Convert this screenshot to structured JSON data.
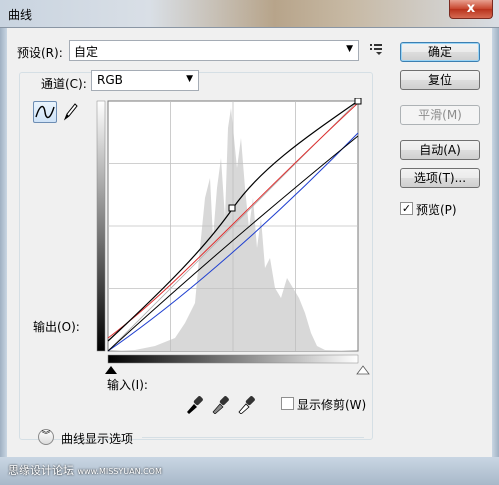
{
  "window": {
    "title": "曲线",
    "close": "x"
  },
  "preset": {
    "label": "预设(R):",
    "value": "自定"
  },
  "channel": {
    "label": "通道(C):",
    "value": "RGB"
  },
  "graph": {
    "output_label": "输出(O):",
    "input_label": "输入(I):"
  },
  "clipping": {
    "label": "显示修剪(W)",
    "checked": false
  },
  "curve_options": {
    "label": "曲线显示选项"
  },
  "buttons": {
    "ok": "确定",
    "reset": "复位",
    "smooth": "平滑(M)",
    "auto": "自动(A)",
    "options": "选项(T)..."
  },
  "preview": {
    "label": "预览(P)",
    "checked": true,
    "mark": "✓"
  },
  "watermark": {
    "text": "思缘设计论坛",
    "url": "www.MISSYUAN.COM"
  },
  "colors": {
    "red_curve": "#e03030",
    "blue_curve": "#2040d0",
    "histogram": "#d8d8d8"
  }
}
